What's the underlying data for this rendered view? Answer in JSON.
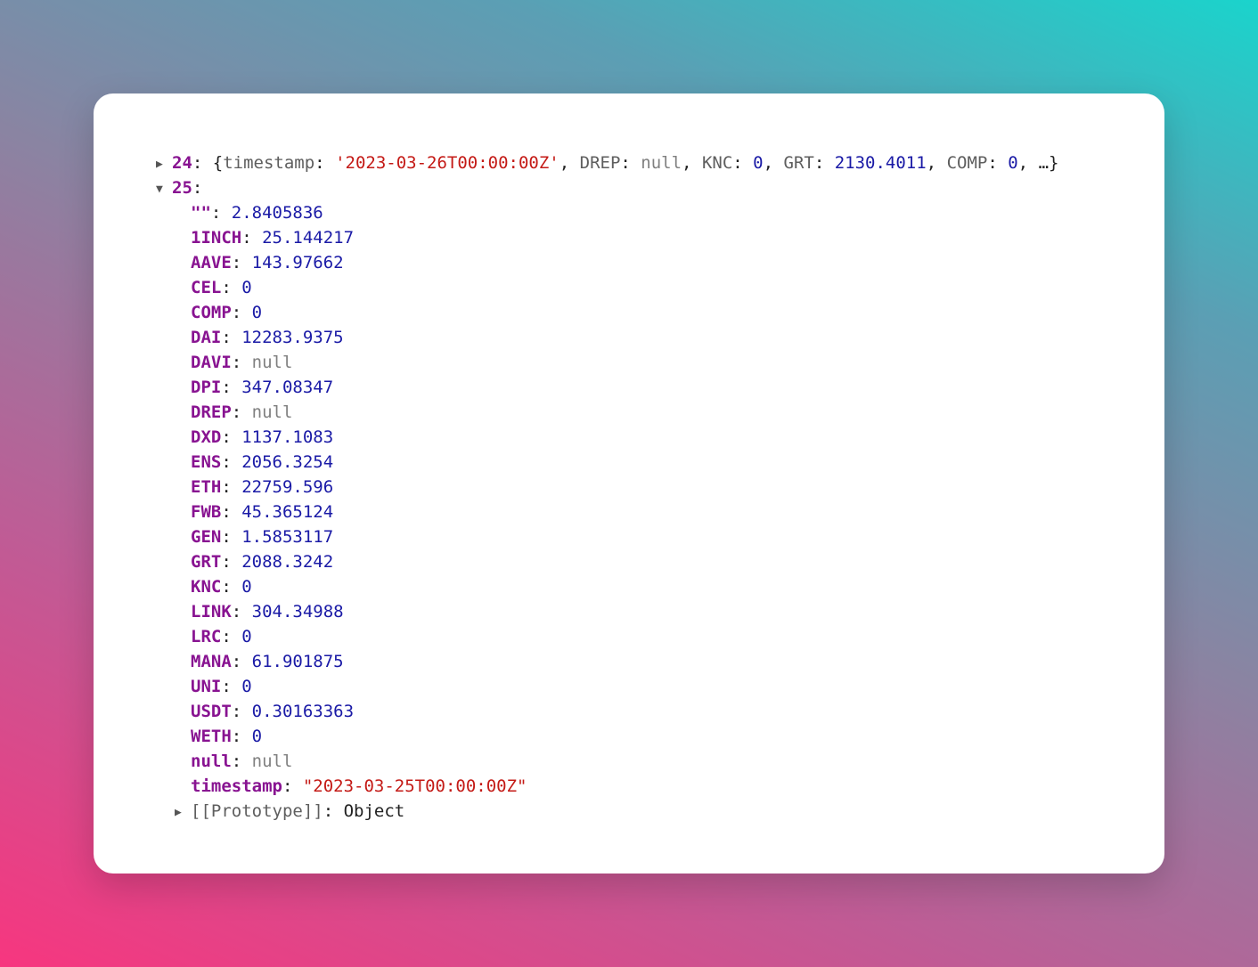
{
  "row24": {
    "index": "24",
    "timestamp_key": "timestamp",
    "timestamp_val": "'2023-03-26T00:00:00Z'",
    "k2": "DREP",
    "v2": "null",
    "k3": "KNC",
    "v3": "0",
    "k4": "GRT",
    "v4": "2130.4011",
    "k5": "COMP",
    "v5": "0",
    "ellipsis": "…"
  },
  "row25": {
    "index": "25",
    "props": [
      {
        "key": "\"\"",
        "value": "2.8405836",
        "type": "num"
      },
      {
        "key": "1INCH",
        "value": "25.144217",
        "type": "num"
      },
      {
        "key": "AAVE",
        "value": "143.97662",
        "type": "num"
      },
      {
        "key": "CEL",
        "value": "0",
        "type": "num"
      },
      {
        "key": "COMP",
        "value": "0",
        "type": "num"
      },
      {
        "key": "DAI",
        "value": "12283.9375",
        "type": "num"
      },
      {
        "key": "DAVI",
        "value": "null",
        "type": "nul"
      },
      {
        "key": "DPI",
        "value": "347.08347",
        "type": "num"
      },
      {
        "key": "DREP",
        "value": "null",
        "type": "nul"
      },
      {
        "key": "DXD",
        "value": "1137.1083",
        "type": "num"
      },
      {
        "key": "ENS",
        "value": "2056.3254",
        "type": "num"
      },
      {
        "key": "ETH",
        "value": "22759.596",
        "type": "num"
      },
      {
        "key": "FWB",
        "value": "45.365124",
        "type": "num"
      },
      {
        "key": "GEN",
        "value": "1.5853117",
        "type": "num"
      },
      {
        "key": "GRT",
        "value": "2088.3242",
        "type": "num"
      },
      {
        "key": "KNC",
        "value": "0",
        "type": "num"
      },
      {
        "key": "LINK",
        "value": "304.34988",
        "type": "num"
      },
      {
        "key": "LRC",
        "value": "0",
        "type": "num"
      },
      {
        "key": "MANA",
        "value": "61.901875",
        "type": "num"
      },
      {
        "key": "UNI",
        "value": "0",
        "type": "num"
      },
      {
        "key": "USDT",
        "value": "0.30163363",
        "type": "num"
      },
      {
        "key": "WETH",
        "value": "0",
        "type": "num"
      },
      {
        "key": "null",
        "value": "null",
        "type": "nul"
      },
      {
        "key": "timestamp",
        "value": "\"2023-03-25T00:00:00Z\"",
        "type": "str"
      }
    ],
    "prototype_key": "[[Prototype]]",
    "prototype_val": "Object"
  },
  "icons": {
    "collapsed": "▶",
    "expanded": "▼"
  }
}
